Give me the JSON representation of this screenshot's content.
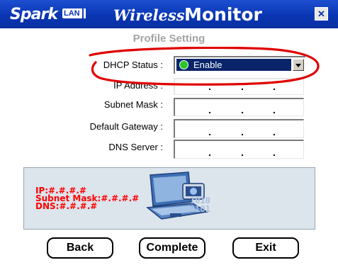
{
  "window": {
    "brand_name": "Spark",
    "brand_tag": "LAN",
    "title_italic": "Wireless",
    "title_bold": "Monitor",
    "close_glyph": "✕"
  },
  "form": {
    "heading": "Profile Setting",
    "dhcp_label": "DHCP Status :",
    "dhcp_value": "Enable",
    "ip_label": "IP Address :",
    "subnet_label": "Subnet Mask :",
    "gateway_label": "Default Gateway :",
    "dns_label": "DNS Server :"
  },
  "info": {
    "ip": "IP:#.#.#.#",
    "subnet": "Subnet Mask:#.#.#.#",
    "dns": "DNS:#.#.#.#",
    "binary1": "1010",
    "binary2": "0101"
  },
  "buttons": {
    "back": "Back",
    "complete": "Complete",
    "exit": "Exit"
  },
  "colors": {
    "titlebar": "#0a36b4",
    "annotation": "#e00000",
    "info_text": "#ff0000",
    "selected_bg": "#0a246a",
    "status_ok": "#2cc42c"
  },
  "icons": [
    "laptop-icon",
    "wireless-card-icon",
    "close-icon",
    "dropdown-arrow-icon",
    "status-dot-icon"
  ]
}
